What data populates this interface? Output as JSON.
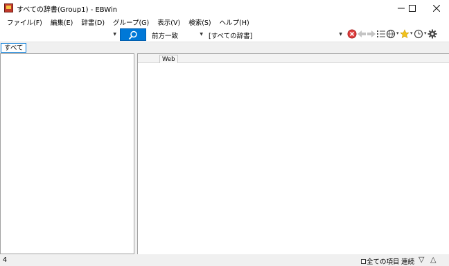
{
  "window": {
    "title": "すべての辞書(Group1) - EBWin"
  },
  "menu": [
    "ファイル(F)",
    "編集(E)",
    "辞書(D)",
    "グループ(G)",
    "表示(V)",
    "検索(S)",
    "ヘルプ(H)"
  ],
  "toolbar": {
    "search_value": "",
    "mode_value": "前方一致",
    "dictionary_value": "[すべての辞書]"
  },
  "tabs": {
    "all_label": "すべて"
  },
  "right_pane": {
    "web_tab_label": "Web"
  },
  "status": {
    "count": "4",
    "all_items_label": "全ての項目",
    "continuous_label": "連続"
  }
}
